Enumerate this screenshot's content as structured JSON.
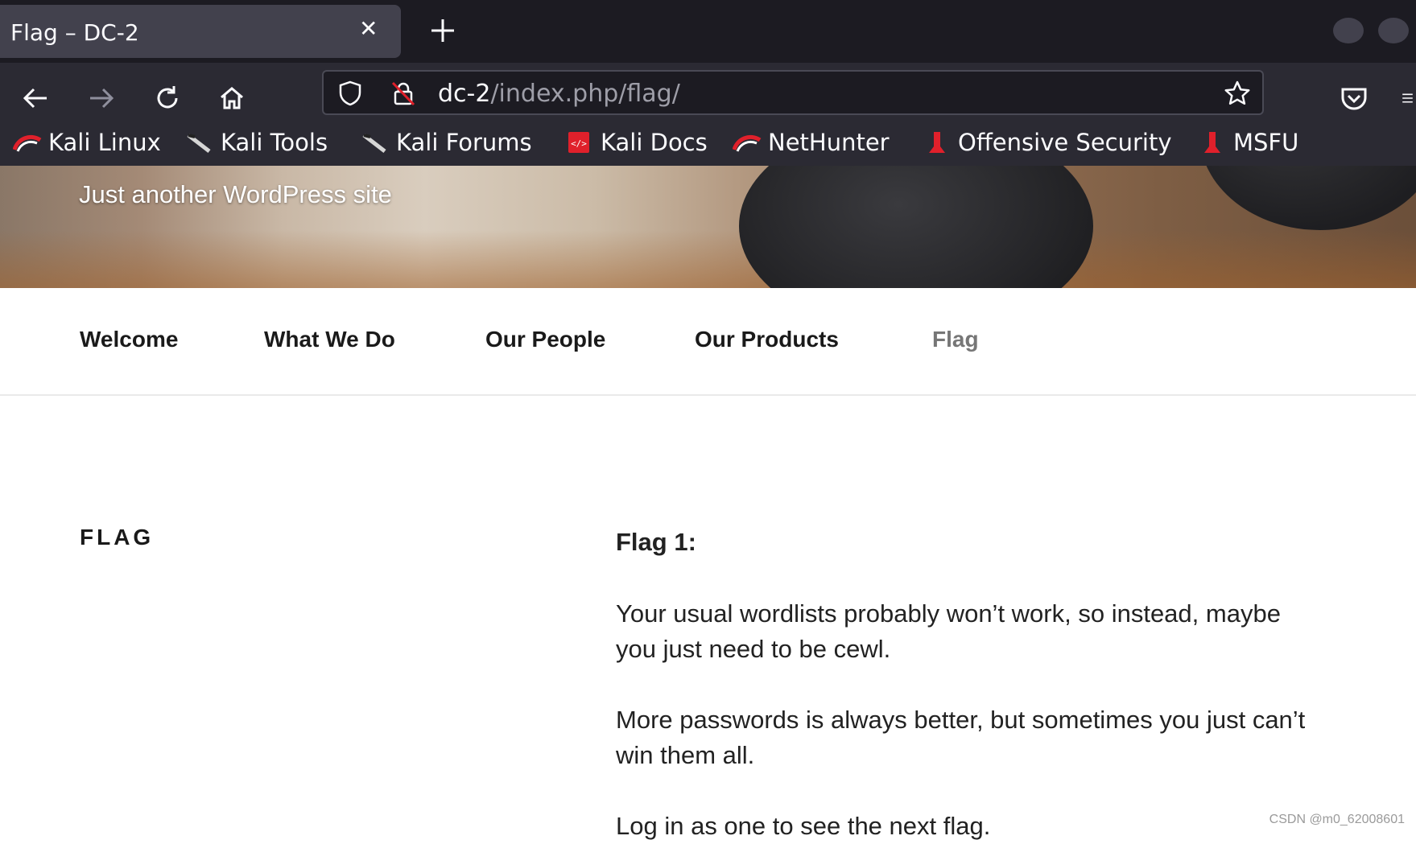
{
  "browser": {
    "tab": {
      "title": "Flag – DC-2"
    },
    "url": {
      "host": "dc-2",
      "path": "/index.php/flag/"
    },
    "bookmarks": [
      {
        "label": "Kali Linux",
        "icon": "kali-dragon-icon"
      },
      {
        "label": "Kali Tools",
        "icon": "kali-tools-icon"
      },
      {
        "label": "Kali Forums",
        "icon": "kali-forums-icon"
      },
      {
        "label": "Kali Docs",
        "icon": "kali-docs-icon"
      },
      {
        "label": "NetHunter",
        "icon": "kali-dragon-icon"
      },
      {
        "label": "Offensive Security",
        "icon": "offsec-icon"
      },
      {
        "label": "MSFU",
        "icon": "offsec-icon"
      }
    ]
  },
  "site": {
    "tagline": "Just another WordPress site",
    "menu": [
      "Welcome",
      "What We Do",
      "Our People",
      "Our Products",
      "Flag"
    ],
    "current_menu_item": "Flag"
  },
  "page": {
    "title": "FLAG",
    "heading": "Flag 1:",
    "paragraphs": [
      "Your usual wordlists probably won’t work, so instead, maybe you just need to be cewl.",
      "More passwords is always better, but sometimes you just can’t win them all.",
      "Log in as one to see the next flag."
    ]
  },
  "watermark": "CSDN @m0_62008601",
  "colors": {
    "chrome_dark": "#1c1b22",
    "toolbar": "#2b2a33",
    "tab_active": "#42414d",
    "kali_red": "#e0202b"
  }
}
